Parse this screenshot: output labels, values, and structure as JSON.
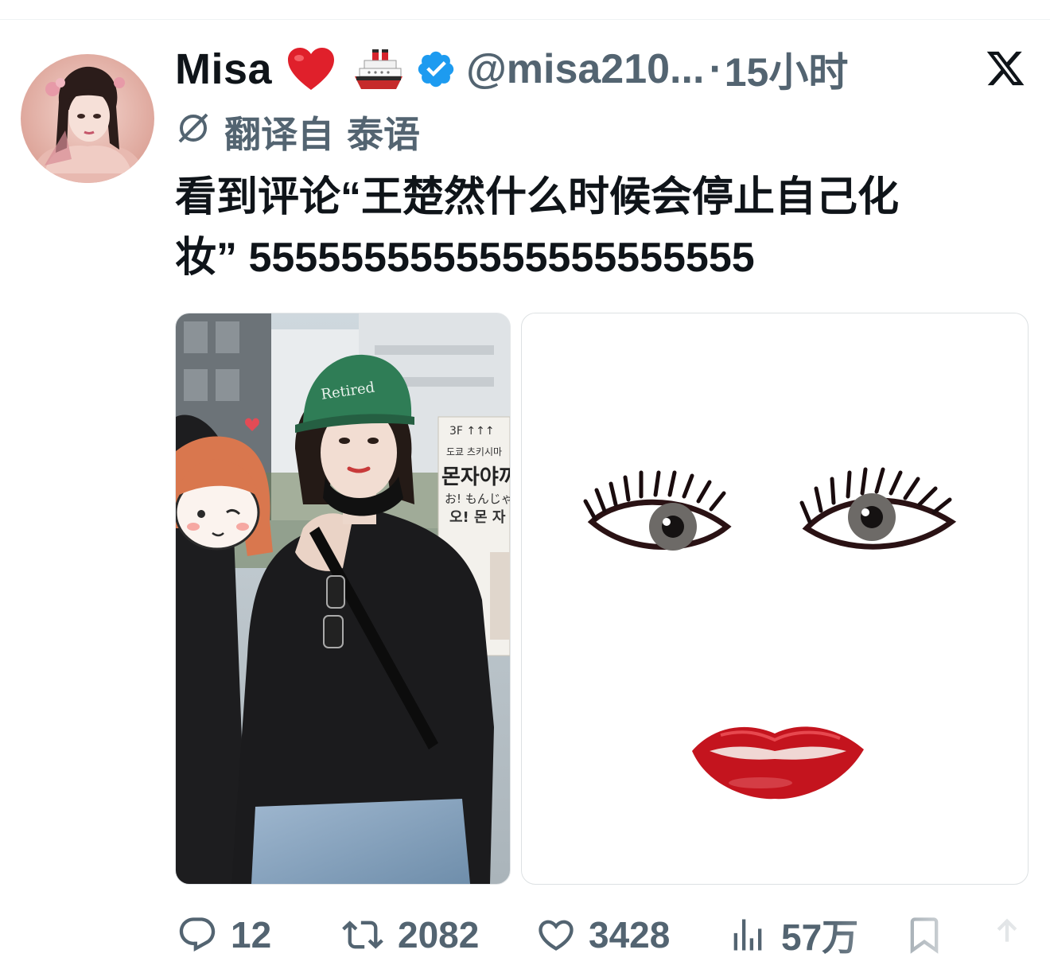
{
  "author": {
    "display_name": "Misa",
    "handle": "@misa210...",
    "time_separator": "·",
    "time_ago": "15小时",
    "emoji_heart": "red-heart-emoji",
    "emoji_ship": "ship-emoji",
    "verified": "verified-badge-icon"
  },
  "translation": {
    "prefix": "翻译自",
    "language": "泰语"
  },
  "tweet": {
    "line1": "看到评论“王楚然什么时候会停止自己化",
    "line2": "妆” 5555555555555555555555"
  },
  "media": {
    "left_cap_text": "Retired",
    "sign_lines": [
      "3F ↑↑↑",
      "도쿄 츠키시마",
      "몬자야끼",
      "お! もんじゃ",
      "오! 몬 자"
    ]
  },
  "actions": {
    "reply_count": "12",
    "retweet_count": "2082",
    "like_count": "3428",
    "views_count": "57万"
  },
  "colors": {
    "text": "#0f1419",
    "secondary": "#536471",
    "verified": "#1d9bf0"
  }
}
